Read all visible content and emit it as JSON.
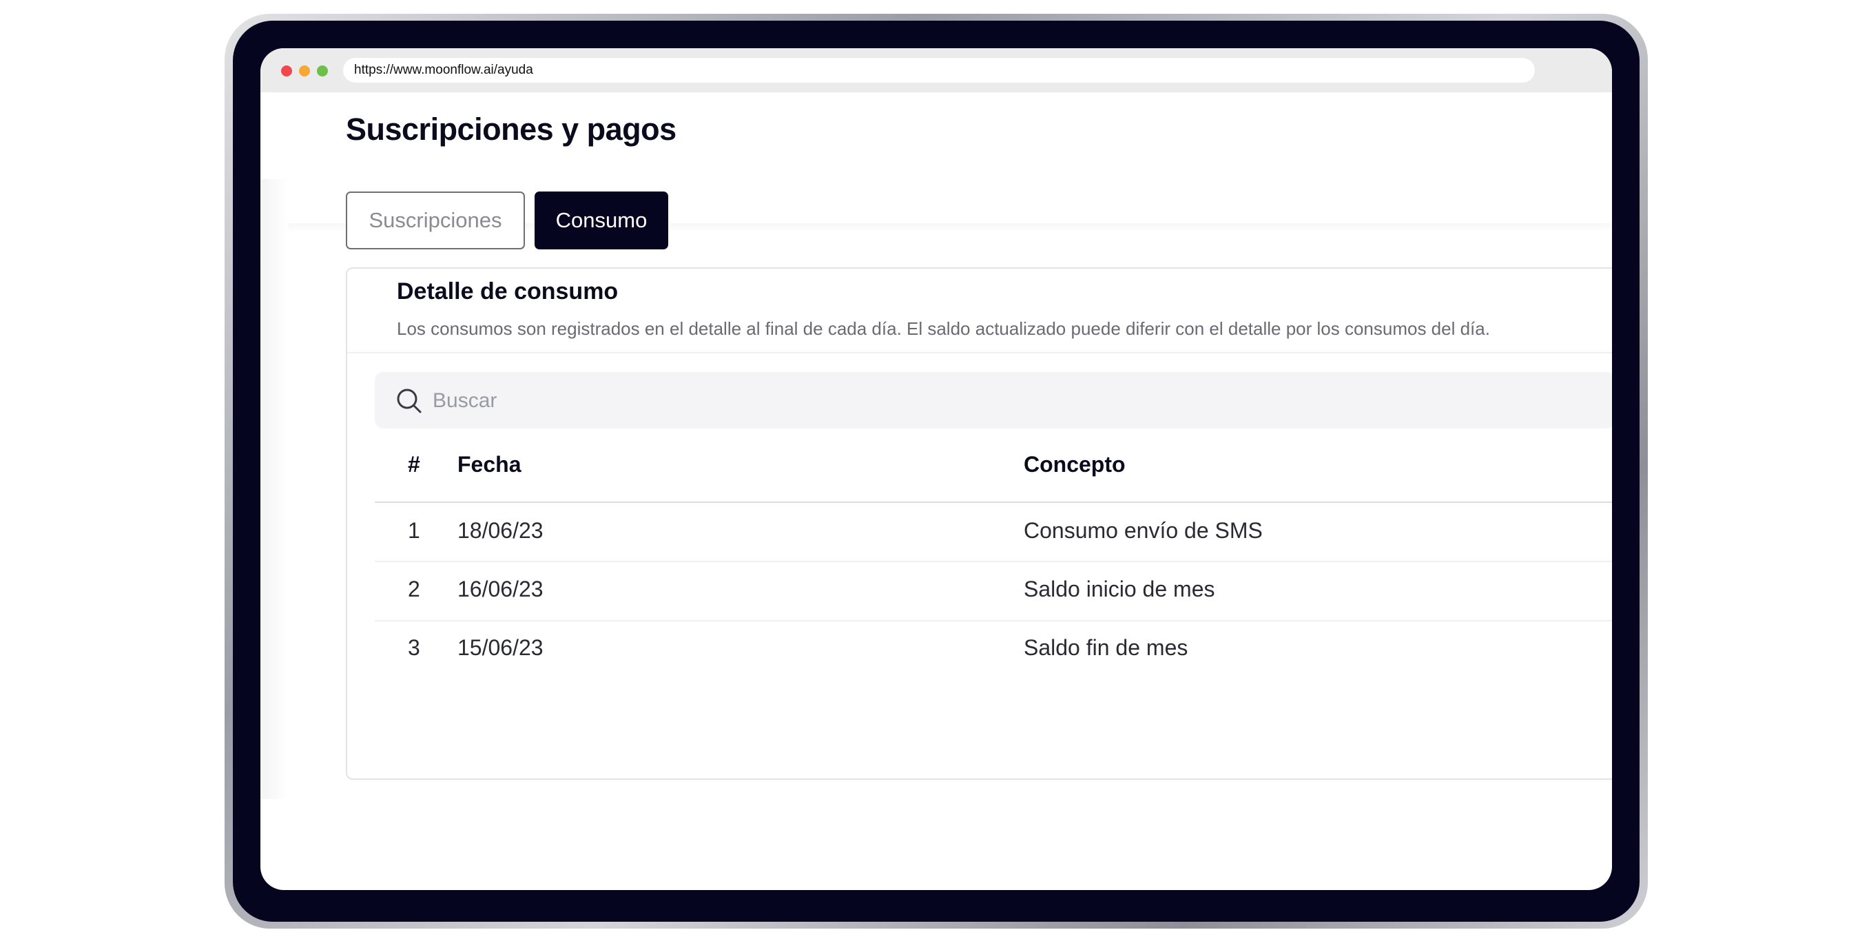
{
  "browser": {
    "url": "https://www.moonflow.ai/ayuda",
    "controls": [
      "close",
      "minimize",
      "maximize"
    ],
    "dot_colors": {
      "close": "#f0484e",
      "minimize": "#f7a832",
      "maximize": "#6cc04a"
    }
  },
  "page": {
    "title": "Suscripciones y pagos"
  },
  "tabs": [
    {
      "label": "Suscripciones",
      "active": false
    },
    {
      "label": "Consumo",
      "active": true
    }
  ],
  "card": {
    "title": "Detalle de consumo",
    "description": "Los consumos son registrados en el detalle al final de cada día. El saldo actualizado puede diferir con el detalle por los consumos del día."
  },
  "search": {
    "icon": "search-icon",
    "placeholder": "Buscar",
    "value": ""
  },
  "table": {
    "columns": [
      "#",
      "Fecha",
      "Concepto"
    ],
    "rows": [
      {
        "num": "1",
        "fecha": "18/06/23",
        "concepto": "Consumo envío de SMS"
      },
      {
        "num": "2",
        "fecha": "16/06/23",
        "concepto": "Saldo inicio de mes"
      },
      {
        "num": "3",
        "fecha": "15/06/23",
        "concepto": "Saldo fin de mes"
      }
    ]
  },
  "colors": {
    "primary_dark": "#05051f",
    "text_dark": "#0b0b1e",
    "muted_text": "#6a6a72",
    "search_bg": "#f4f4f6"
  }
}
